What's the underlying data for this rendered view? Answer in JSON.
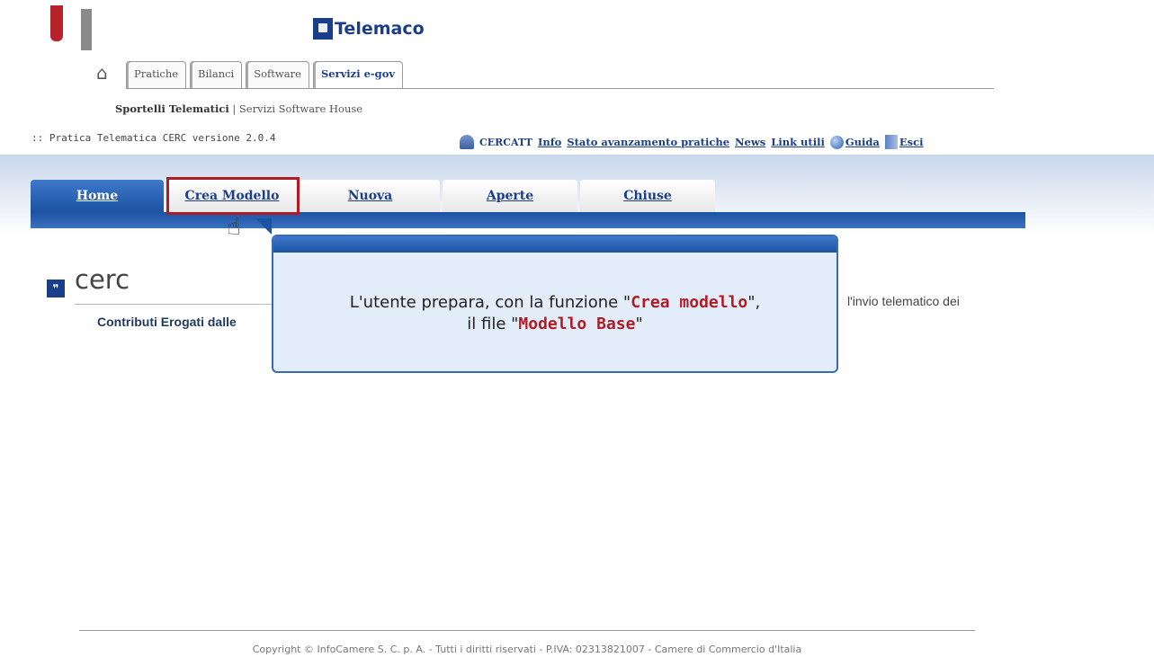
{
  "brand": {
    "name": "Telemaco"
  },
  "top_tabs": [
    {
      "label": "Pratiche"
    },
    {
      "label": "Bilanci"
    },
    {
      "label": "Software"
    },
    {
      "label": "Servizi e-gov",
      "active": true
    }
  ],
  "sub_links": {
    "primary": "Sportelli Telematici",
    "separator": " | ",
    "secondary": "Servizi Software House"
  },
  "version_text": ":: Pratica Telematica CERC versione 2.0.4",
  "utility": {
    "user": "CERCATT",
    "info": "Info",
    "stato": "Stato avanzamento pratiche",
    "news": "News",
    "link_utili": "Link utili",
    "guida": "Guida",
    "esci": "Esci"
  },
  "main_tabs": [
    {
      "label": "Home",
      "active": true
    },
    {
      "label": "Crea Modello"
    },
    {
      "label": "Nuova"
    },
    {
      "label": "Aperte"
    },
    {
      "label": "Chiuse"
    }
  ],
  "cerc": {
    "title": "cerc",
    "subtitle": "Contributi Erogati dalle",
    "right_text": "l'invio telematico dei"
  },
  "callout": {
    "line1_prefix": "L'utente prepara, con la funzione \"",
    "line1_highlight": "Crea modello",
    "line1_suffix": "\",",
    "line2_prefix": "il file \"",
    "line2_highlight": "Modello Base",
    "line2_suffix": "\""
  },
  "footer": "Copyright © InfoCamere S. C. p. A. - Tutti i diritti riservati - P.IVA: 02313821007 - Camere di Commercio d'Italia",
  "colors": {
    "accent": "#1c53a3",
    "highlight": "#b01c24"
  }
}
